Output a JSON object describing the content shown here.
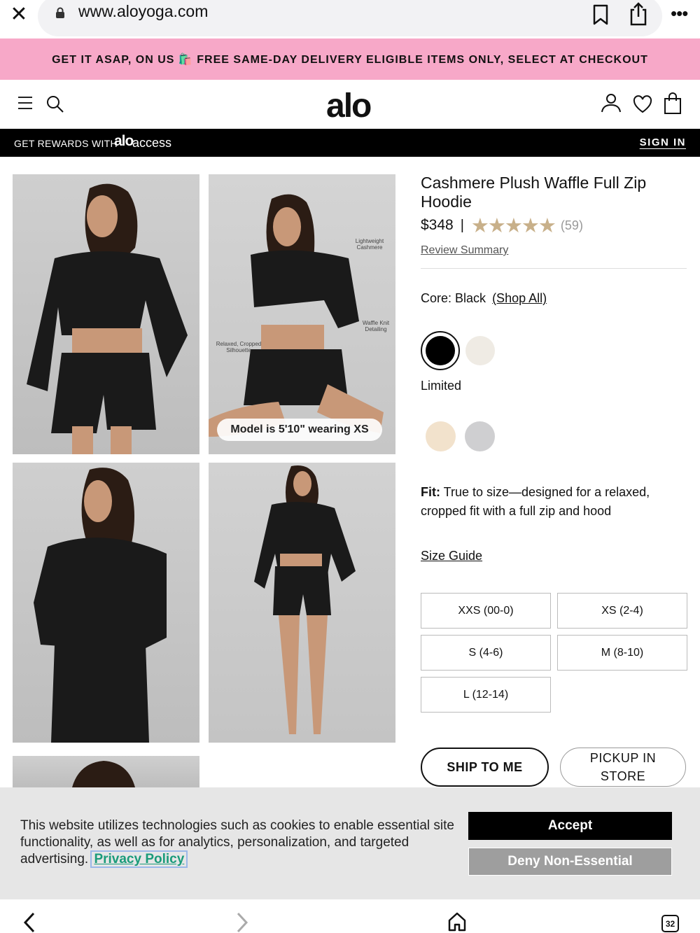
{
  "browser": {
    "url": "www.aloyoga.com",
    "tab_count": "32"
  },
  "promo": {
    "text": "GET IT ASAP, ON US 🛍️ FREE SAME-DAY DELIVERY ELIGIBLE ITEMS ONLY, SELECT AT CHECKOUT"
  },
  "header": {
    "logo": "alo"
  },
  "rewards": {
    "text": "GET REWARDS WITH",
    "logo": "alo",
    "access": "access",
    "sign_in": "SIGN IN"
  },
  "gallery": {
    "model_badge": "Model is 5'10\" wearing XS",
    "callouts": {
      "lightweight": "Lightweight Cashmere",
      "waffle": "Waffle Knit Detailing",
      "relaxed": "Relaxed, Cropped Silhouette"
    }
  },
  "product": {
    "title": "Cashmere Plush Waffle Full Zip Hoodie",
    "price": "$348",
    "separator": "|",
    "rating_stars": "★★★★★",
    "rating_value": 4.5,
    "review_count": "(59)",
    "review_summary": "Review Summary",
    "color_label": "Core: Black",
    "shop_all": "(Shop All)",
    "limited_label": "Limited",
    "fit_label": "Fit:",
    "fit_text": "True to size—designed for a relaxed, cropped fit with a full zip and hood",
    "size_guide": "Size Guide",
    "sizes": [
      "XXS (00-0)",
      "XS (2-4)",
      "S (4-6)",
      "M (8-10)",
      "L (12-14)"
    ],
    "ship_to_me": "SHIP TO ME",
    "pickup_in_store": "PICKUP IN STORE",
    "swatch_colors": {
      "black": "#000000",
      "ivory": "#efebe4",
      "cream": "#f2e2cc",
      "grey": "#cfcfd1"
    }
  },
  "cookie": {
    "text": "This website utilizes technologies such as cookies to enable essential site functionality, as well as for analytics, personalization, and targeted advertising.",
    "privacy_link": "Privacy Policy",
    "accept": "Accept",
    "deny": "Deny Non-Essential"
  },
  "colors": {
    "promo_bg": "#f7a8c8",
    "star_color": "#c8b08a",
    "privacy_link": "#1a9b7a"
  }
}
